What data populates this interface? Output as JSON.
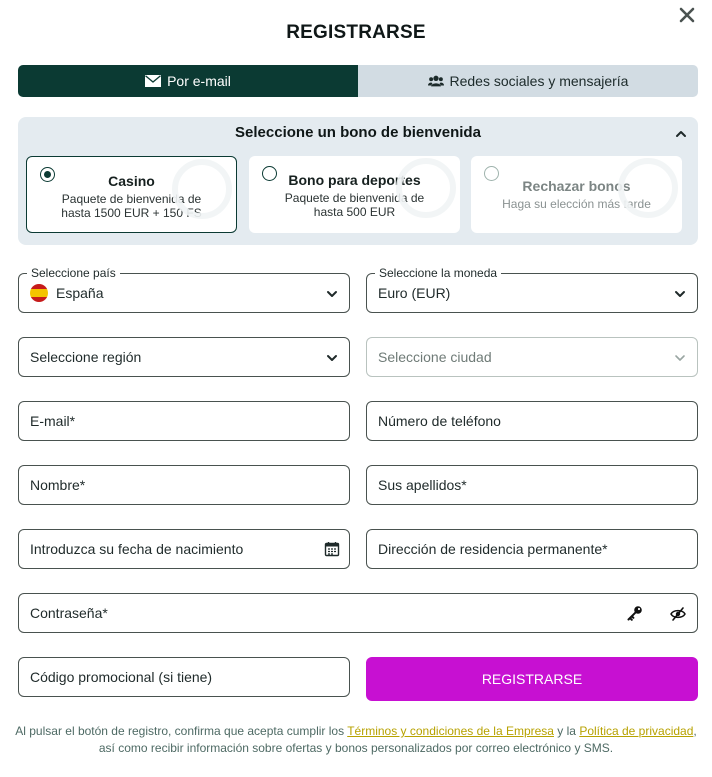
{
  "dialog": {
    "title": "REGISTRARSE",
    "close_icon": "close-icon"
  },
  "tabs": [
    {
      "label": "Por e-mail",
      "icon": "envelope-icon",
      "active": true
    },
    {
      "label": "Redes sociales y mensajería",
      "icon": "users-icon",
      "active": false
    }
  ],
  "bonus": {
    "header": "Seleccione un bono de bienvenida",
    "options": [
      {
        "title": "Casino",
        "description": "Paquete de bienvenida de hasta 1500 EUR + 150 FS",
        "selected": true
      },
      {
        "title": "Bono para deportes",
        "description": "Paquete de bienvenida de hasta 500 EUR",
        "selected": false
      },
      {
        "title": "Rechazar bonos",
        "description": "Haga su elección más tarde",
        "selected": false
      }
    ]
  },
  "form": {
    "country": {
      "label": "Seleccione país",
      "value": "España"
    },
    "currency": {
      "label": "Seleccione la moneda",
      "value": "Euro (EUR)"
    },
    "region": {
      "placeholder": "Seleccione región"
    },
    "city": {
      "placeholder": "Seleccione ciudad"
    },
    "email": {
      "placeholder": "E-mail*"
    },
    "phone": {
      "placeholder": "Número de teléfono"
    },
    "first_name": {
      "placeholder": "Nombre*"
    },
    "last_name": {
      "placeholder": "Sus apellidos*"
    },
    "birth_date": {
      "placeholder": "Introduzca su fecha de nacimiento"
    },
    "address": {
      "placeholder": "Dirección de residencia permanente*"
    },
    "password": {
      "placeholder": "Contraseña*"
    },
    "promo": {
      "placeholder": "Código promocional (si tiene)"
    },
    "submit_label": "REGISTRARSE"
  },
  "footer": {
    "text_1": "Al pulsar el botón de registro, confirma que acepta cumplir los ",
    "terms_link": "Términos y condiciones de la Empresa",
    "text_2": " y la ",
    "privacy_link": "Política de privacidad",
    "text_3": ",",
    "text_4": "así como recibir información sobre ofertas y bonos personalizados por correo electrónico y SMS."
  },
  "colors": {
    "primary_dark": "#0b3a33",
    "tab_inactive": "#d2dce3",
    "panel_bg": "#e4ebf0",
    "register_button": "#c710d2",
    "link": "#b7a200"
  }
}
